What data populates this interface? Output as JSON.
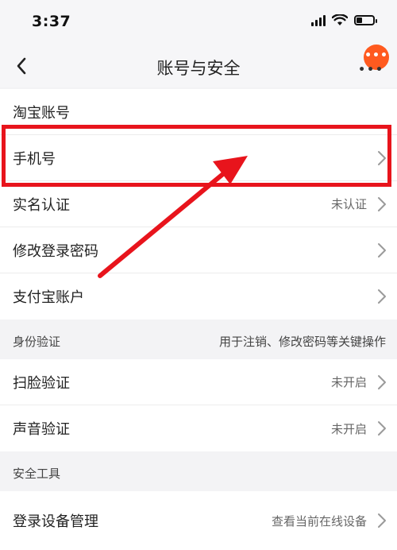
{
  "status_bar": {
    "time": "3:37"
  },
  "nav": {
    "title": "账号与安全",
    "more_dots": "•••"
  },
  "account_section": {
    "rows": [
      {
        "label": "淘宝账号",
        "value": ""
      },
      {
        "label": "手机号",
        "value": ""
      },
      {
        "label": "实名认证",
        "value": "未认证"
      },
      {
        "label": "修改登录密码",
        "value": ""
      },
      {
        "label": "支付宝账户",
        "value": ""
      }
    ]
  },
  "identity_section": {
    "title": "身份验证",
    "note": "用于注销、修改密码等关键操作",
    "rows": [
      {
        "label": "扫脸验证",
        "value": "未开启"
      },
      {
        "label": "声音验证",
        "value": "未开启"
      }
    ]
  },
  "tools_section": {
    "title": "安全工具",
    "rows": [
      {
        "label": "登录设备管理",
        "value": "查看当前在线设备"
      }
    ]
  },
  "colors": {
    "accent": "#ff5a1f",
    "annotation": "#e8141c"
  }
}
